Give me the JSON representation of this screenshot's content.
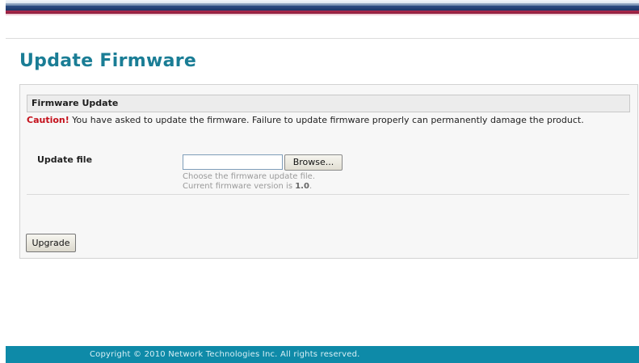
{
  "page": {
    "title": "Update Firmware"
  },
  "panel": {
    "header": "Firmware Update",
    "caution_label": "Caution!",
    "caution_text": " You have asked to update the firmware. Failure to update firmware properly can permanently damage the product.",
    "update_file_label": "Update file",
    "file_input_value": "",
    "browse_label": "Browse...",
    "hint_choose": "Choose the firmware update file.",
    "hint_version_prefix": "Current firmware version is ",
    "firmware_version": "1.0",
    "hint_version_suffix": ".",
    "upgrade_label": "Upgrade"
  },
  "footer": {
    "copyright": "Copyright © 2010 Network Technologies Inc. All rights reserved."
  },
  "colors": {
    "title": "#1a7d95",
    "caution": "#c4101b",
    "footer_bg": "#0e8aa8",
    "stripe_blue": "#1b3568",
    "stripe_red": "#8c1c3c"
  }
}
